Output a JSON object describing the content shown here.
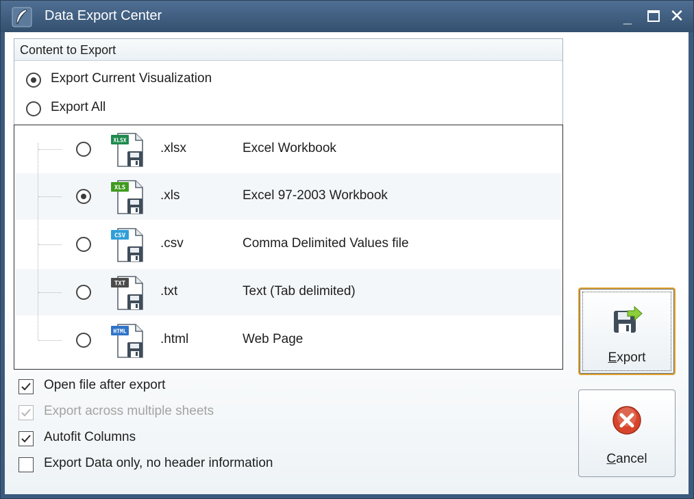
{
  "window": {
    "title": "Data Export Center",
    "controls": {
      "minimize": "_",
      "close": "✕"
    }
  },
  "content_group": {
    "header": "Content to Export",
    "options": [
      {
        "label": "Export Current Visualization",
        "selected": true
      },
      {
        "label": "Export All",
        "selected": false
      }
    ]
  },
  "formats": [
    {
      "badge": "XLSX",
      "badge_color": "#1e8a4e",
      "ext": ".xlsx",
      "desc": "Excel Workbook",
      "selected": false
    },
    {
      "badge": "XLS",
      "badge_color": "#3f9b1e",
      "ext": ".xls",
      "desc": "Excel 97-2003 Workbook",
      "selected": true
    },
    {
      "badge": "CSV",
      "badge_color": "#2f9fd8",
      "ext": ".csv",
      "desc": "Comma Delimited Values file",
      "selected": false
    },
    {
      "badge": "TXT",
      "badge_color": "#4a4a4a",
      "ext": ".txt",
      "desc": "Text (Tab delimited)",
      "selected": false
    },
    {
      "badge": "HTML",
      "badge_color": "#2f74c8",
      "ext": ".html",
      "desc": "Web Page",
      "selected": false
    }
  ],
  "options": [
    {
      "label": "Open file after export",
      "checked": true,
      "disabled": false
    },
    {
      "label": "Export across multiple sheets",
      "checked": true,
      "disabled": true
    },
    {
      "label": "Autofit Columns",
      "checked": true,
      "disabled": false
    },
    {
      "label": "Export Data only, no header information",
      "checked": false,
      "disabled": false
    }
  ],
  "buttons": {
    "export": {
      "mnemonic": "E",
      "rest": "xport"
    },
    "cancel": {
      "mnemonic": "C",
      "rest": "ancel"
    }
  },
  "icons": {
    "app": "feather-icon",
    "export": "floppy-export-icon",
    "cancel": "error-x-icon"
  }
}
